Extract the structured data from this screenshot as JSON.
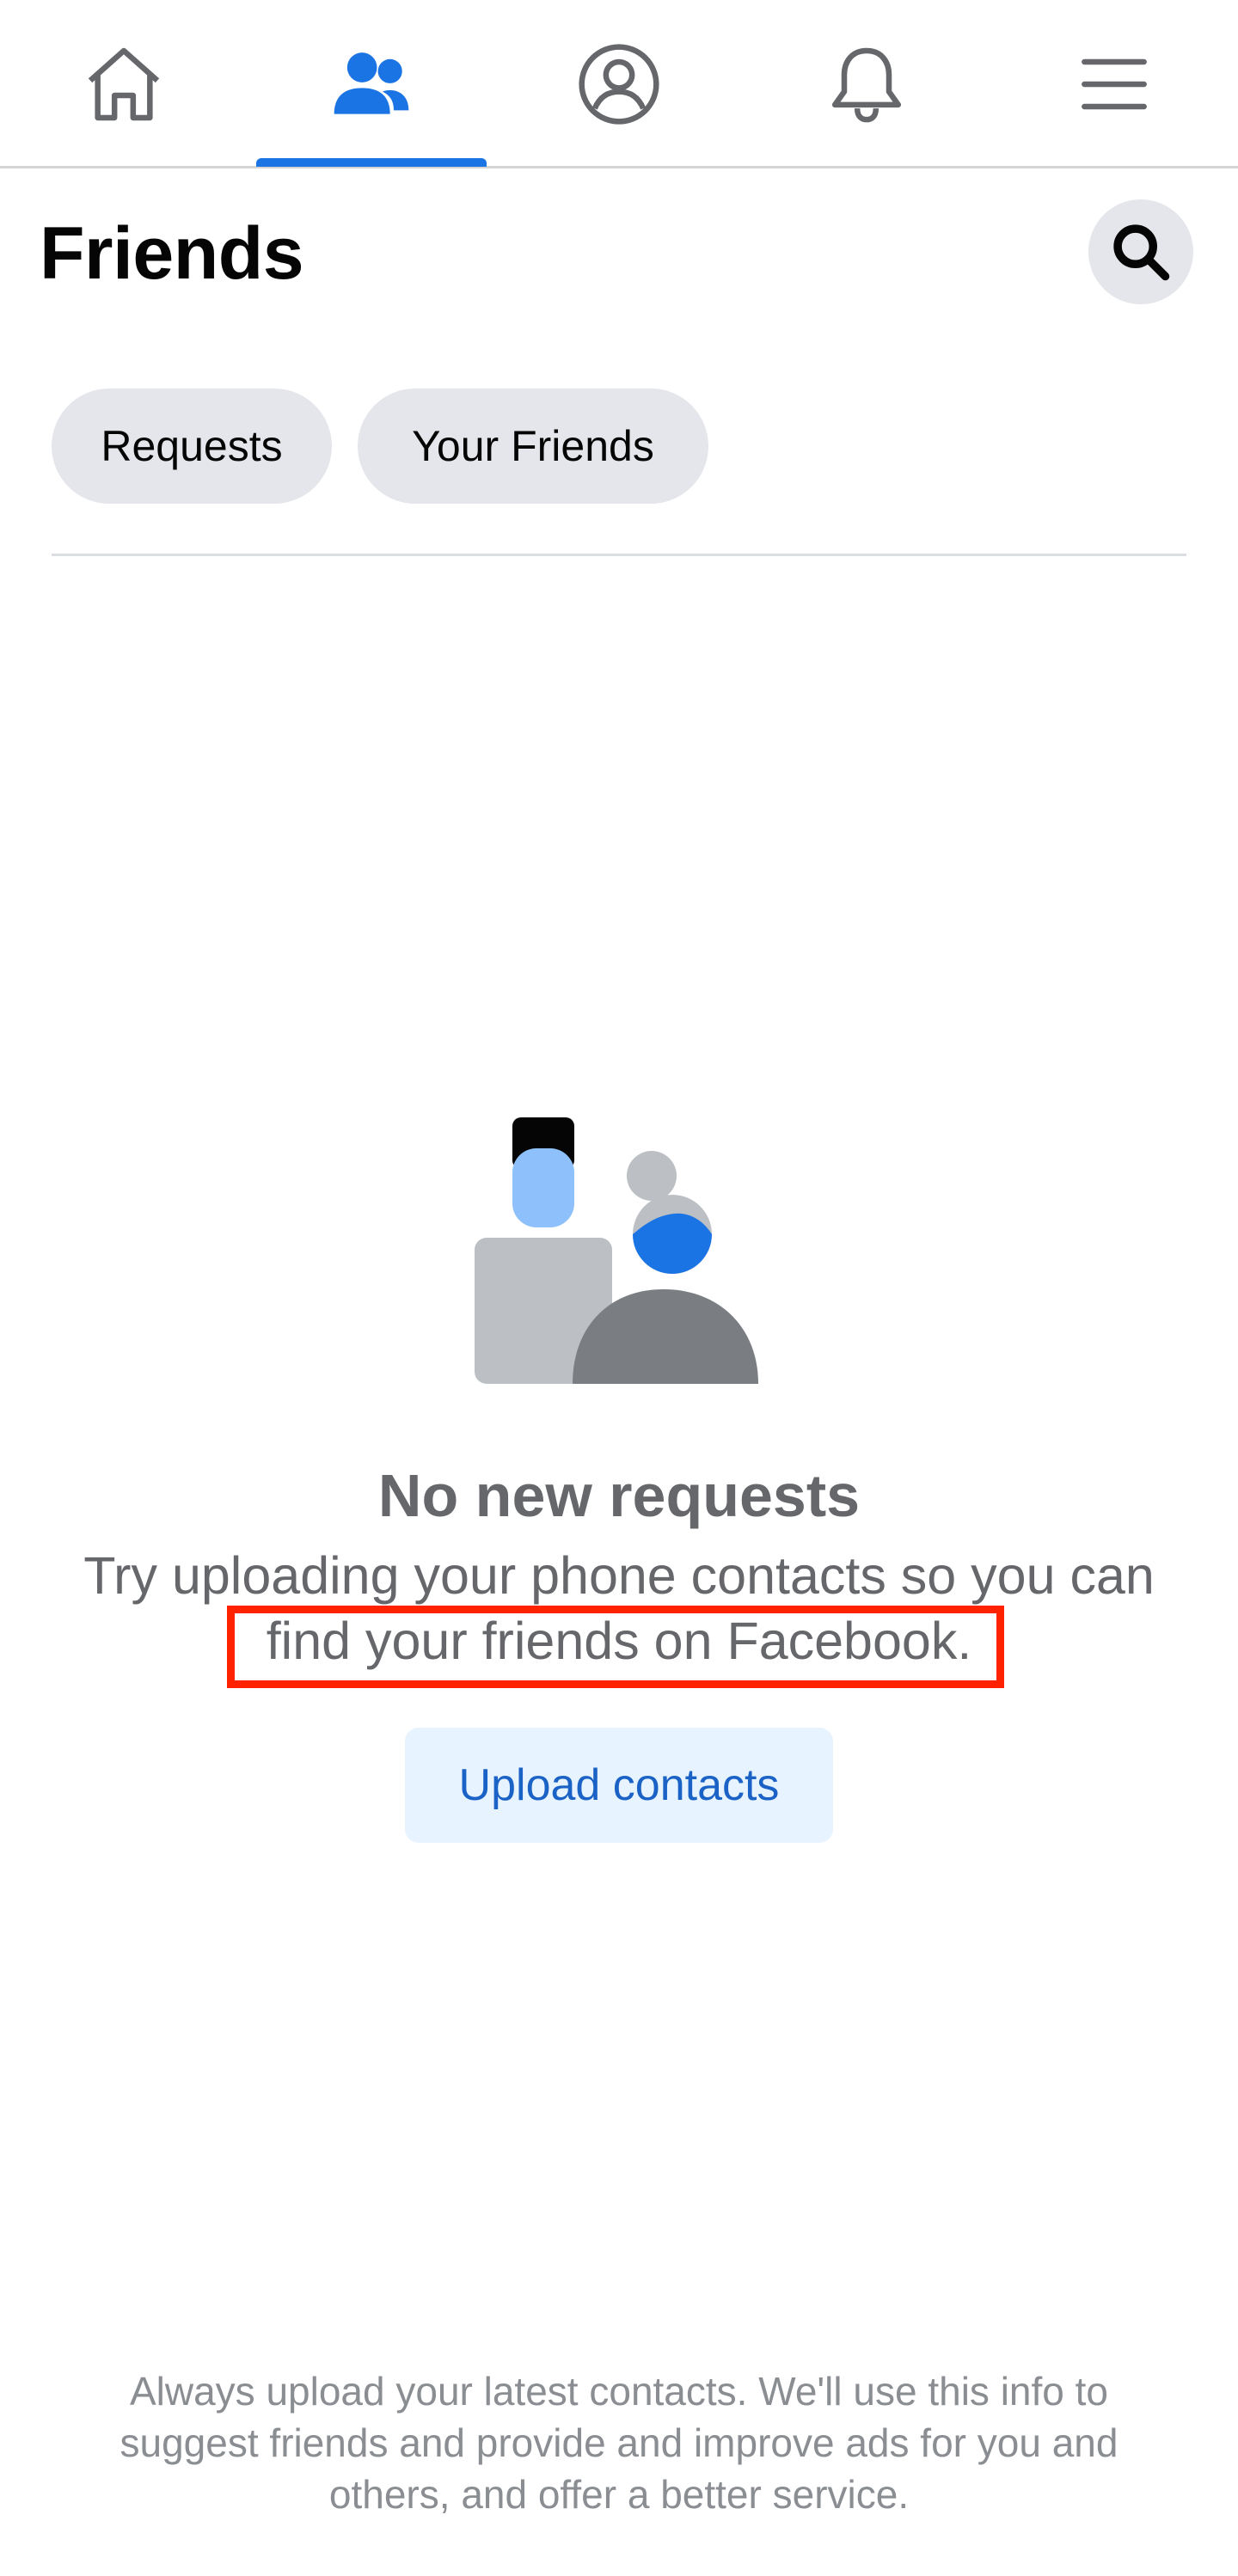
{
  "nav": {
    "items": [
      {
        "name": "home",
        "icon": "home-icon",
        "active": false
      },
      {
        "name": "friends",
        "icon": "friends-icon",
        "active": true
      },
      {
        "name": "profile",
        "icon": "profile-icon",
        "active": false
      },
      {
        "name": "notifications",
        "icon": "bell-icon",
        "active": false
      },
      {
        "name": "menu",
        "icon": "hamburger-menu-icon",
        "active": false
      }
    ],
    "active_color": "#1b74e4",
    "inactive_color": "#65676b"
  },
  "header": {
    "title": "Friends",
    "search_icon": "search-icon"
  },
  "tabs": {
    "requests": "Requests",
    "your_friends": "Your Friends"
  },
  "empty_state": {
    "illustration": "people-illustration",
    "title": "No new requests",
    "description": "Try uploading your phone contacts so you can find your friends on Facebook.",
    "button": "Upload contacts"
  },
  "footer": {
    "note": "Always upload your latest contacts. We'll use this info to suggest friends and provide and improve ads for you and others, and offer a better service."
  },
  "colors": {
    "highlight": "#ff2200",
    "button_bg": "#e7f3ff",
    "button_text": "#1b62c6"
  }
}
